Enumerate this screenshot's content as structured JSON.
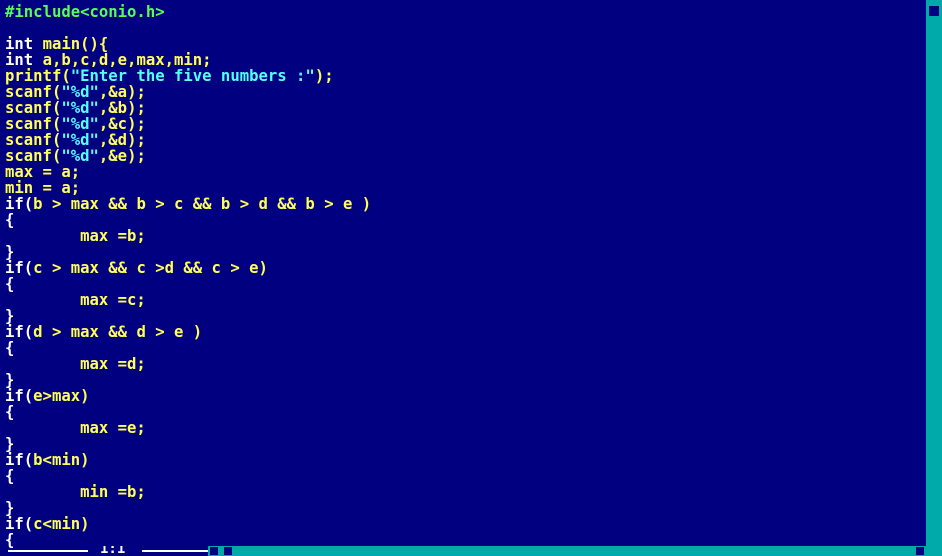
{
  "editor": {
    "background": "#000080",
    "colors": {
      "preprocessor": "#55FF55",
      "keyword": "#FFFFFF",
      "identifier": "#FFFF55",
      "string": "#55FFFF"
    },
    "lines": [
      [
        {
          "t": "pre",
          "s": "#include<conio.h>"
        }
      ],
      [],
      [
        {
          "t": "kw",
          "s": "int "
        },
        {
          "t": "fn",
          "s": "main(){"
        }
      ],
      [
        {
          "t": "kw",
          "s": "int "
        },
        {
          "t": "fn",
          "s": "a,b,c,d,e,max,min;"
        }
      ],
      [
        {
          "t": "fn",
          "s": "printf("
        },
        {
          "t": "str",
          "s": "\"Enter the five numbers :\""
        },
        {
          "t": "fn",
          "s": ");"
        }
      ],
      [
        {
          "t": "fn",
          "s": "scanf("
        },
        {
          "t": "str",
          "s": "\"%d\""
        },
        {
          "t": "fn",
          "s": ",&a);"
        }
      ],
      [
        {
          "t": "fn",
          "s": "scanf("
        },
        {
          "t": "str",
          "s": "\"%d\""
        },
        {
          "t": "fn",
          "s": ",&b);"
        }
      ],
      [
        {
          "t": "fn",
          "s": "scanf("
        },
        {
          "t": "str",
          "s": "\"%d\""
        },
        {
          "t": "fn",
          "s": ",&c);"
        }
      ],
      [
        {
          "t": "fn",
          "s": "scanf("
        },
        {
          "t": "str",
          "s": "\"%d\""
        },
        {
          "t": "fn",
          "s": ",&d);"
        }
      ],
      [
        {
          "t": "fn",
          "s": "scanf("
        },
        {
          "t": "str",
          "s": "\"%d\""
        },
        {
          "t": "fn",
          "s": ",&e);"
        }
      ],
      [
        {
          "t": "fn",
          "s": "max = a;"
        }
      ],
      [
        {
          "t": "fn",
          "s": "min = a;"
        }
      ],
      [
        {
          "t": "kw",
          "s": "if("
        },
        {
          "t": "fn",
          "s": "b > max && b > c && b > d && b > e )"
        }
      ],
      [
        {
          "t": "kw",
          "s": "{"
        }
      ],
      [
        {
          "t": "fn",
          "s": "        max =b;"
        }
      ],
      [
        {
          "t": "kw",
          "s": "}"
        }
      ],
      [
        {
          "t": "kw",
          "s": "if("
        },
        {
          "t": "fn",
          "s": "c > max && c >d && c > e)"
        }
      ],
      [
        {
          "t": "kw",
          "s": "{"
        }
      ],
      [
        {
          "t": "fn",
          "s": "        max =c;"
        }
      ],
      [
        {
          "t": "kw",
          "s": "}"
        }
      ],
      [
        {
          "t": "kw",
          "s": "if("
        },
        {
          "t": "fn",
          "s": "d > max && d > e )"
        }
      ],
      [
        {
          "t": "kw",
          "s": "{"
        }
      ],
      [
        {
          "t": "fn",
          "s": "        max =d;"
        }
      ],
      [
        {
          "t": "kw",
          "s": "}"
        }
      ],
      [
        {
          "t": "kw",
          "s": "if("
        },
        {
          "t": "fn",
          "s": "e>max)"
        }
      ],
      [
        {
          "t": "kw",
          "s": "{"
        }
      ],
      [
        {
          "t": "fn",
          "s": "        max =e;"
        }
      ],
      [
        {
          "t": "kw",
          "s": "}"
        }
      ],
      [
        {
          "t": "kw",
          "s": "if("
        },
        {
          "t": "fn",
          "s": "b<min)"
        }
      ],
      [
        {
          "t": "kw",
          "s": "{"
        }
      ],
      [
        {
          "t": "fn",
          "s": "        min =b;"
        }
      ],
      [
        {
          "t": "kw",
          "s": "}"
        }
      ],
      [
        {
          "t": "kw",
          "s": "if("
        },
        {
          "t": "fn",
          "s": "c<min)"
        }
      ],
      [
        {
          "t": "kw",
          "s": "{"
        }
      ]
    ]
  },
  "statusbar": {
    "cursor_position": "1:1"
  },
  "scrollbars": {
    "color": "#00AAAA",
    "thumb_color": "#000080"
  }
}
